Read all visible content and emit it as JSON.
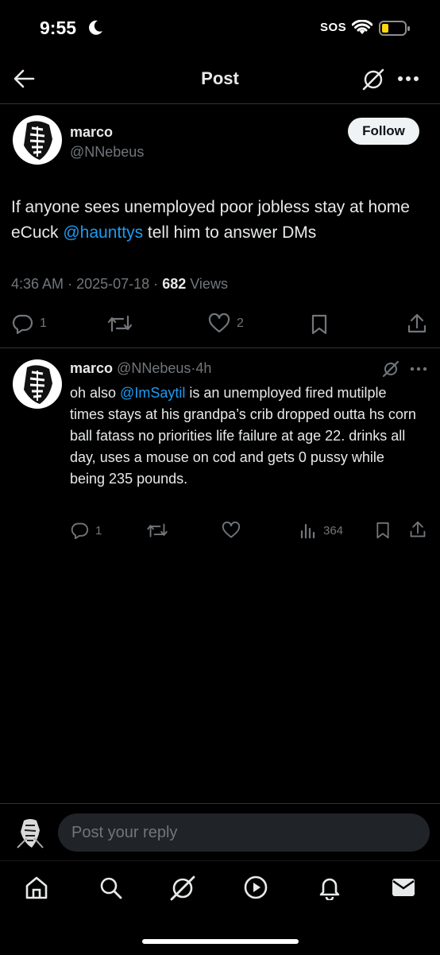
{
  "status_bar": {
    "time": "9:55",
    "sos": "SOS"
  },
  "header": {
    "title": "Post"
  },
  "post": {
    "author_name": "marco",
    "author_handle": "@NNebeus",
    "follow_label": "Follow",
    "text_part1": "If anyone sees unemployed poor jobless stay at home eCuck ",
    "mention": "@haunttys",
    "text_part2": " tell him to answer DMs",
    "time": "4:36 AM",
    "sep": "·",
    "date": "2025-07-18",
    "views_count": "682",
    "views_label": "Views",
    "replies": "1",
    "likes": "2"
  },
  "reply": {
    "author_name": "marco",
    "author_handle": "@NNebeus",
    "sep": "·",
    "age": "4h",
    "text_part1": "oh also ",
    "mention": "@ImSaytil",
    "text_part2": " is an unemployed fired mutilple times stays at his grandpa’s crib dropped outta hs corn ball fatass no priorities life failure at age 22. drinks all day, uses a mouse on cod and gets 0 pussy while being 235 pounds.",
    "replies": "1",
    "views": "364"
  },
  "composer": {
    "placeholder": "Post your reply"
  },
  "colors": {
    "accent": "#1d9bf0",
    "background": "#000000",
    "muted": "#71767b"
  },
  "icons": [
    "back-arrow-icon",
    "grok-icon",
    "more-icon",
    "reply-icon",
    "repost-icon",
    "like-icon",
    "bookmark-icon",
    "share-icon",
    "views-icon",
    "home-icon",
    "search-icon",
    "play-icon",
    "bell-icon",
    "mail-icon"
  ]
}
